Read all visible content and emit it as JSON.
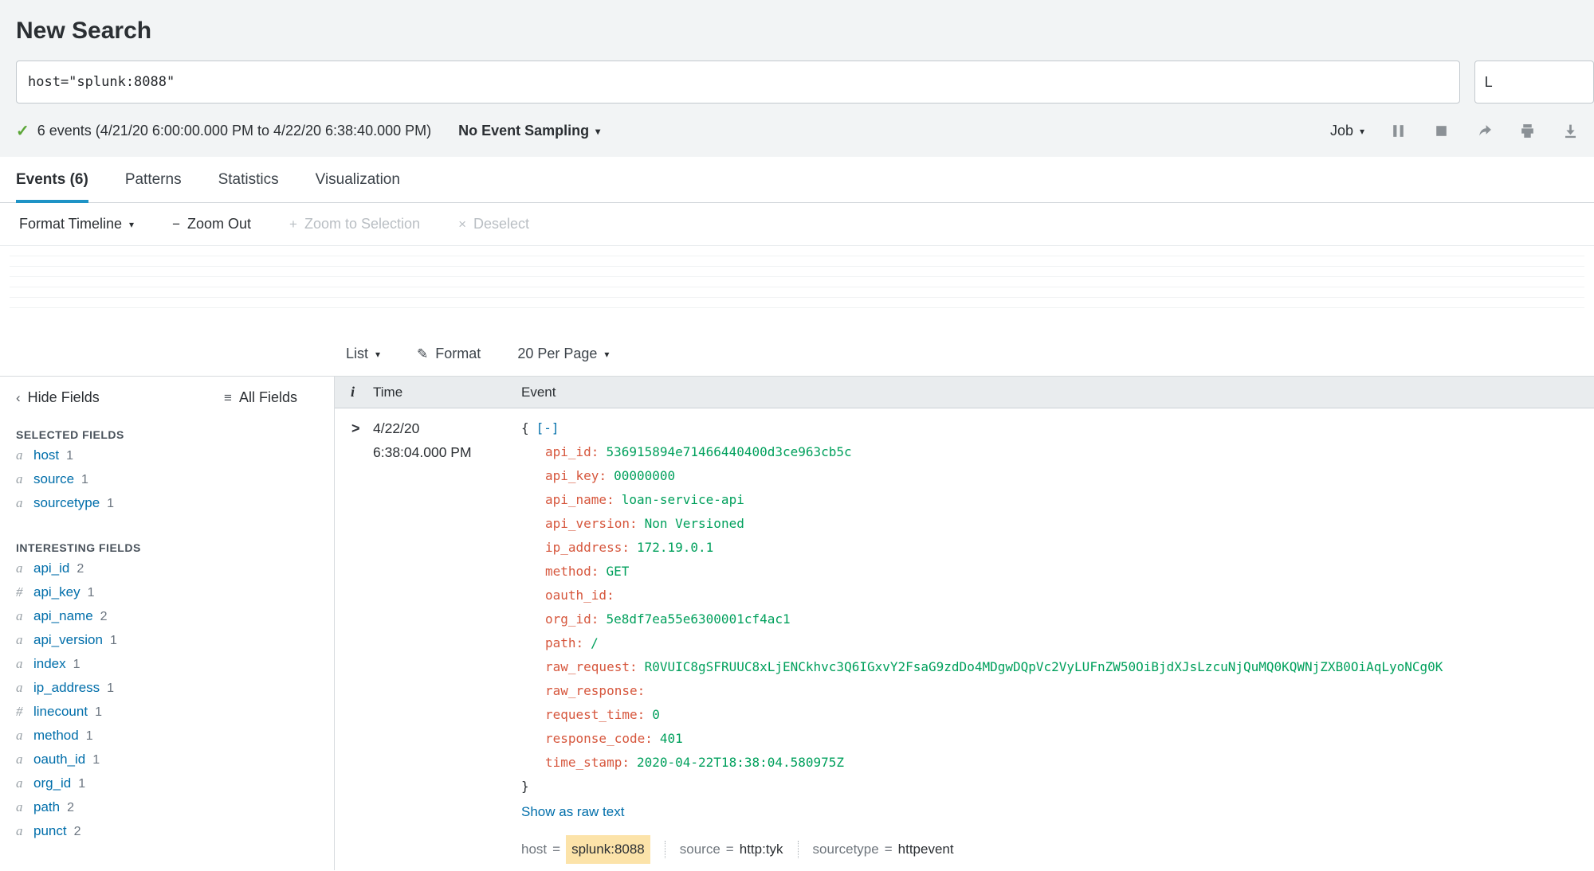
{
  "colors": {
    "accent": "#1e93c6",
    "link": "#006eaa",
    "key": "#d6563c",
    "val": "#00a05c",
    "check": "#5ba637",
    "hl": "#fce3a9"
  },
  "header": {
    "title": "New Search",
    "search_query": "host=\"splunk:8088\"",
    "time_range_sliver": "L",
    "status_text": "6 events (4/21/20 6:00:00.000 PM to 4/22/20 6:38:40.000 PM)",
    "sampling_label": "No Event Sampling",
    "job_label": "Job"
  },
  "icons": {
    "check": "✓",
    "caret_down": "▾",
    "minus": "−",
    "plus": "+",
    "close": "×",
    "pencil": "✎",
    "list_glyph": "≡",
    "chevron_left": "‹",
    "expand_chevron": ">"
  },
  "tabs": [
    {
      "label": "Events (6)"
    },
    {
      "label": "Patterns"
    },
    {
      "label": "Statistics"
    },
    {
      "label": "Visualization"
    }
  ],
  "timeline_toolbar": {
    "format_timeline": "Format Timeline",
    "zoom_out": "Zoom Out",
    "zoom_to_selection": "Zoom to Selection",
    "deselect": "Deselect"
  },
  "results_toolbar": {
    "list": "List",
    "format": "Format",
    "per_page": "20 Per Page"
  },
  "sidebar": {
    "hide_fields": "Hide Fields",
    "all_fields": "All Fields",
    "selected_header": "SELECTED FIELDS",
    "interesting_header": "INTERESTING FIELDS",
    "selected": [
      {
        "type": "a",
        "name": "host",
        "count": "1"
      },
      {
        "type": "a",
        "name": "source",
        "count": "1"
      },
      {
        "type": "a",
        "name": "sourcetype",
        "count": "1"
      }
    ],
    "interesting": [
      {
        "type": "a",
        "name": "api_id",
        "count": "2"
      },
      {
        "type": "#",
        "name": "api_key",
        "count": "1"
      },
      {
        "type": "a",
        "name": "api_name",
        "count": "2"
      },
      {
        "type": "a",
        "name": "api_version",
        "count": "1"
      },
      {
        "type": "a",
        "name": "index",
        "count": "1"
      },
      {
        "type": "a",
        "name": "ip_address",
        "count": "1"
      },
      {
        "type": "#",
        "name": "linecount",
        "count": "1"
      },
      {
        "type": "a",
        "name": "method",
        "count": "1"
      },
      {
        "type": "a",
        "name": "oauth_id",
        "count": "1"
      },
      {
        "type": "a",
        "name": "org_id",
        "count": "1"
      },
      {
        "type": "a",
        "name": "path",
        "count": "2"
      },
      {
        "type": "a",
        "name": "punct",
        "count": "2"
      }
    ]
  },
  "table": {
    "col_info": "i",
    "col_time": "Time",
    "col_event": "Event"
  },
  "event": {
    "date": "4/22/20",
    "time": "6:38:04.000 PM",
    "open_brace": "{",
    "close_brace": "}",
    "collapse": "[-]",
    "colon": ":",
    "equals": "=",
    "fields": [
      {
        "key": "api_id",
        "value": "536915894e71466440400d3ce963cb5c"
      },
      {
        "key": "api_key",
        "value": "00000000"
      },
      {
        "key": "api_name",
        "value": "loan-service-api"
      },
      {
        "key": "api_version",
        "value": "Non Versioned"
      },
      {
        "key": "ip_address",
        "value": "172.19.0.1"
      },
      {
        "key": "method",
        "value": "GET"
      },
      {
        "key": "oauth_id",
        "value": ""
      },
      {
        "key": "org_id",
        "value": "5e8df7ea55e6300001cf4ac1"
      },
      {
        "key": "path",
        "value": "/"
      },
      {
        "key": "raw_request",
        "value": "R0VUIC8gSFRUUC8xLjENCkhvc3Q6IGxvY2FsaG9zdDo4MDgwDQpVc2VyLUFnZW50OiBjdXJsLzcuNjQuMQ0KQWNjZXB0OiAqLyoNCg0K"
      },
      {
        "key": "raw_response",
        "value": ""
      },
      {
        "key": "request_time",
        "value": "0"
      },
      {
        "key": "response_code",
        "value": "401"
      },
      {
        "key": "time_stamp",
        "value": "2020-04-22T18:38:04.580975Z"
      }
    ],
    "show_raw": "Show as raw text",
    "footer": [
      {
        "label": "host",
        "value": "splunk:8088"
      },
      {
        "label": "source",
        "value": "http:tyk"
      },
      {
        "label": "sourcetype",
        "value": "httpevent"
      }
    ]
  }
}
